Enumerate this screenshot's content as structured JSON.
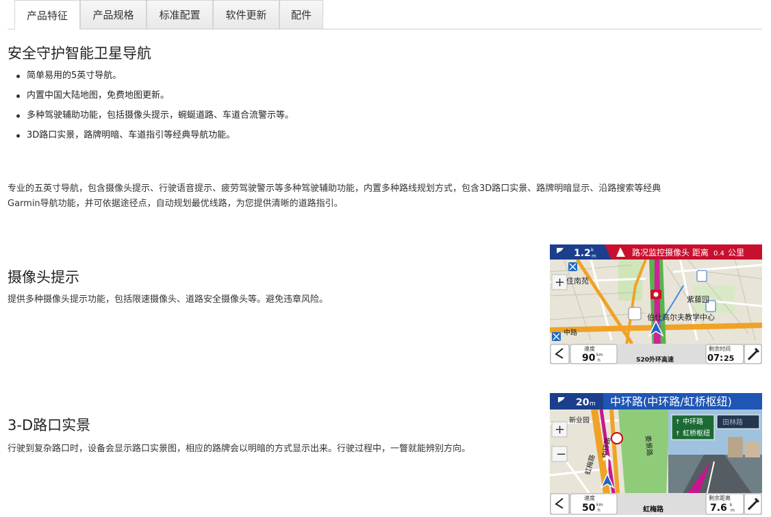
{
  "tabs": [
    "产品特征",
    "产品规格",
    "标准配置",
    "软件更新",
    "配件"
  ],
  "section1": {
    "title": "安全守护智能卫星导航",
    "bullets": [
      "简单易用的5英寸导航。",
      "内置中国大陆地图，免费地图更新。",
      "多种驾驶辅助功能，包括摄像头提示，蜿蜒道路、车道合流警示等。",
      "3D路口实景，路牌明暗、车道指引等经典导航功能。"
    ]
  },
  "intro": {
    "line1": "专业的五英寸导航，包含摄像头提示、行驶语音提示、疲劳驾驶警示等多种驾驶辅助功能，内置多种路线规划方式，包含3D路口实景、路牌明暗显示、沿路搜索等经典",
    "line2": "Garmin导航功能，并可依据途径点，自动规划最优线路，为您提供清晰的道路指引。"
  },
  "section2": {
    "title": "摄像头提示",
    "text": "提供多种摄像头提示功能，包括限速摄像头、道路安全摄像头等。避免违章风险。",
    "screen": {
      "turn_dist": "1.2",
      "turn_unit_top": "k",
      "turn_unit_bot": "m",
      "alert": "路况监控摄像头 距离",
      "alert_dist": "0.4",
      "alert_unit": "公里",
      "poi1": "佳南苑",
      "poi2": "紫藤园",
      "poi3": "伯仕高尔夫教学中心",
      "road_left": "中路",
      "speed_label": "速度",
      "speed": "90",
      "speed_unit_top": "km",
      "speed_unit_bot": "h",
      "road_name": "S20外环高速",
      "time_label": "剩余时间",
      "time_h": "07",
      "time_m": "25"
    }
  },
  "section3": {
    "title": "3-D路口实景",
    "text": "行驶到复杂路口时，设备会显示路口实景图，相应的路牌会以明暗的方式显示出来。行驶过程中，一瞥就能辨别方向。",
    "screen": {
      "turn_dist": "20",
      "turn_unit": "m",
      "road_header": "中环路(中环路/虹桥枢纽)",
      "map_label1": "新业园",
      "map_label2": "中环路",
      "map_label3": "虹梅路",
      "map_label4": "娄景路",
      "sign1": "中环路",
      "sign2": "虹桥枢纽",
      "sign3": "田林路",
      "speed_label": "速度",
      "speed": "50",
      "speed_unit_top": "km",
      "speed_unit_bot": "h",
      "road_name": "虹梅路",
      "dist_label": "剩余距离",
      "dist": "7.6",
      "dist_unit_top": "k",
      "dist_unit_bot": "m"
    }
  }
}
